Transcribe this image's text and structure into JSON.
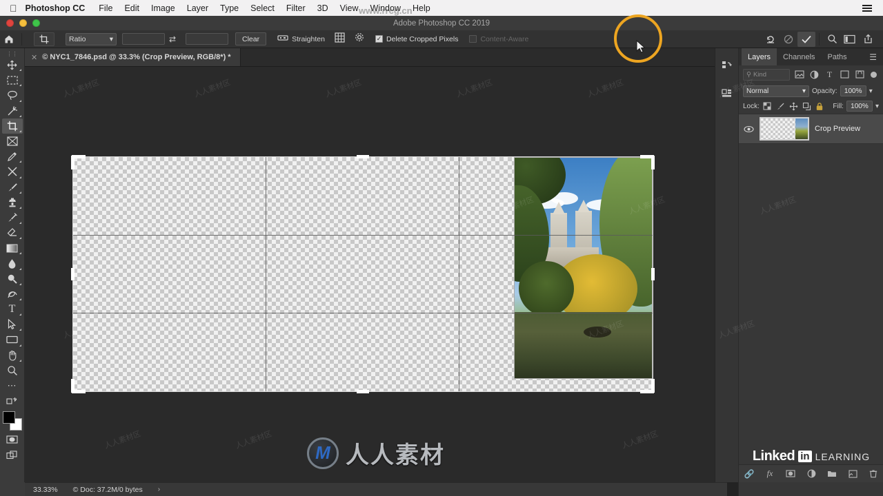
{
  "macmenu": {
    "apple": "apple-logo",
    "app_name": "Photoshop CC",
    "items": [
      "File",
      "Edit",
      "Image",
      "Layer",
      "Type",
      "Select",
      "Filter",
      "3D",
      "View",
      "Window",
      "Help"
    ]
  },
  "window": {
    "title": "Adobe Photoshop CC 2019"
  },
  "options_bar": {
    "home_icon": "home-icon",
    "tool_icon": "crop-tool-icon",
    "ratio_label": "Ratio",
    "width_value": "",
    "height_value": "",
    "swap_icon": "swap-arrows-icon",
    "clear_label": "Clear",
    "straighten_label": "Straighten",
    "straighten_icon": "straighten-icon",
    "grid_icon": "overlay-grid-icon",
    "gear_icon": "crop-settings-gear-icon",
    "delete_cropped_label": "Delete Cropped Pixels",
    "delete_cropped_checked": true,
    "content_aware_label": "Content-Aware",
    "content_aware_checked": false,
    "reset_icon": "reset-icon",
    "cancel_icon": "cancel-crop-icon",
    "commit_icon": "commit-crop-checkmark-icon",
    "search_icon": "search-icon",
    "workspace_icon": "workspace-switcher-icon",
    "share_icon": "share-icon"
  },
  "document": {
    "tab_title": "© NYC1_7846.psd @ 33.3% (Crop Preview, RGB/8*) *",
    "close_icon": "close-tab-icon"
  },
  "toolbar": {
    "tools": [
      {
        "name": "move-tool",
        "glyph": "✥",
        "active": false
      },
      {
        "name": "marquee-tool",
        "glyph": "▭",
        "active": false
      },
      {
        "name": "lasso-tool",
        "glyph": "◯",
        "active": false
      },
      {
        "name": "magic-wand-tool",
        "glyph": "✨",
        "active": false
      },
      {
        "name": "crop-tool",
        "glyph": "⌗",
        "active": true
      },
      {
        "name": "frame-tool",
        "glyph": "⊠",
        "active": false
      },
      {
        "name": "eyedropper-tool",
        "glyph": "✎",
        "active": false
      },
      {
        "name": "healing-brush-tool",
        "glyph": "✂",
        "active": false
      },
      {
        "name": "brush-tool",
        "glyph": "🖌",
        "active": false
      },
      {
        "name": "clone-stamp-tool",
        "glyph": "▲",
        "active": false
      },
      {
        "name": "history-brush-tool",
        "glyph": "🖋",
        "active": false
      },
      {
        "name": "eraser-tool",
        "glyph": "◣",
        "active": false
      },
      {
        "name": "gradient-tool",
        "glyph": "▤",
        "active": false
      },
      {
        "name": "blur-tool",
        "glyph": "💧",
        "active": false
      },
      {
        "name": "dodge-tool",
        "glyph": "🔍",
        "active": false
      },
      {
        "name": "pen-tool",
        "glyph": "✒",
        "active": false
      },
      {
        "name": "type-tool",
        "glyph": "T",
        "active": false
      },
      {
        "name": "path-selection-tool",
        "glyph": "➤",
        "active": false
      },
      {
        "name": "rectangle-tool",
        "glyph": "▬",
        "active": false
      },
      {
        "name": "hand-tool",
        "glyph": "✋",
        "active": false
      },
      {
        "name": "zoom-tool",
        "glyph": "🔎",
        "active": false
      },
      {
        "name": "more-tools",
        "glyph": "•••",
        "active": false
      },
      {
        "name": "edit-toolbar",
        "glyph": "⧉",
        "active": false
      }
    ],
    "foreground_color": "#000000",
    "background_color": "#ffffff",
    "quick_mask_icon": "quick-mask-icon",
    "screen_mode_icon": "screen-mode-icon"
  },
  "canvas": {
    "crop_overlay": "rule-of-thirds",
    "photo_alt": "central-park-san-remo-towers-autumn-lake"
  },
  "watermarks": {
    "center_text": "人人素材",
    "tile_text": "人人素材区",
    "url_text": "www.rrcg.cn",
    "linkedin_word": "Linked",
    "linkedin_in": "in",
    "linkedin_learning": "LEARNING"
  },
  "panels": {
    "strip_icons": [
      "history-panel-icon",
      "properties-panel-icon"
    ],
    "tabs": [
      {
        "label": "Layers",
        "active": true
      },
      {
        "label": "Channels",
        "active": false
      },
      {
        "label": "Paths",
        "active": false
      }
    ],
    "menu_icon": "panel-menu-icon",
    "filter": {
      "kind_label": "Kind",
      "search_icon": "filter-search-icon",
      "icons": [
        "filter-pixel-icon",
        "filter-adjustment-icon",
        "filter-type-icon",
        "filter-shape-icon",
        "filter-smart-object-icon"
      ],
      "toggle_icon": "filter-toggle-icon"
    },
    "blend_mode": "Normal",
    "opacity_label": "Opacity:",
    "opacity_value": "100%",
    "lock_label": "Lock:",
    "lock_icons": [
      "lock-transparent-pixels-icon",
      "lock-image-pixels-icon",
      "lock-position-icon",
      "lock-artboard-icon",
      "lock-all-icon"
    ],
    "fill_label": "Fill:",
    "fill_value": "100%",
    "layers": [
      {
        "name": "Crop Preview",
        "visible": true,
        "eye_icon": "eye-icon",
        "thumb": "layer-thumbnail"
      }
    ],
    "bottom_icons": [
      "link-layers-icon",
      "layer-style-fx-icon",
      "add-mask-icon",
      "adjustment-layer-icon",
      "new-group-icon",
      "new-layer-icon",
      "delete-layer-icon"
    ]
  },
  "status_bar": {
    "zoom": "33.33%",
    "doc_info": "© Doc: 37.2M/0 bytes",
    "arrow_icon": "status-expand-arrow-icon"
  }
}
